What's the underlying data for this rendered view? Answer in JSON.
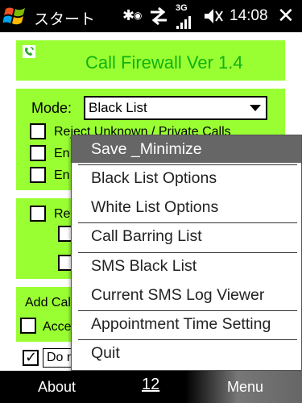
{
  "status_bar": {
    "start_label": "スタート",
    "network_label": "3G",
    "time": "14:08",
    "icons": [
      "windows-flag-icon",
      "bluetooth-icon",
      "sync-arrows-icon",
      "signal-icon",
      "speaker-muted-icon",
      "close-icon"
    ]
  },
  "app": {
    "title": "Call Firewall Ver 1.4",
    "accent_color": "#99ff33",
    "title_color": "#11b211"
  },
  "mode": {
    "label": "Mode:",
    "selected": "Black List"
  },
  "options": {
    "reject_unknown_label": "Reject Unknown / Private Calls",
    "enable_1_label": "En",
    "enable_2_label": "En",
    "re_label": "Re",
    "add_label": "Add Cal",
    "accept_label": "Acce",
    "dont_label": "Do n"
  },
  "menu": {
    "items": [
      {
        "label": "Save _Minimize",
        "selected": true
      },
      {
        "label": "Black List Options"
      },
      {
        "label": "White List Options"
      },
      {
        "label": "Call Barring List"
      },
      {
        "label": "SMS Black List"
      },
      {
        "label": "Current SMS Log Viewer"
      },
      {
        "label": "Appointment Time Setting"
      },
      {
        "label": "Quit"
      }
    ]
  },
  "softkeys": {
    "left": "About",
    "center": "12",
    "right": "Menu"
  }
}
